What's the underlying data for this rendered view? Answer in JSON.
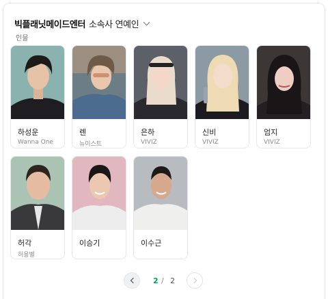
{
  "header": {
    "title_bold": "빅플래닛메이드엔터",
    "title_rest": "소속사 연예인",
    "subtitle": "인물"
  },
  "people": [
    {
      "name": "하성운",
      "group": "Wanna One"
    },
    {
      "name": "렌",
      "group": "뉴이스트"
    },
    {
      "name": "은하",
      "group": "VIVIZ"
    },
    {
      "name": "신비",
      "group": "VIVIZ"
    },
    {
      "name": "엄지",
      "group": "VIVIZ"
    },
    {
      "name": "허각",
      "group": "허용별"
    },
    {
      "name": "이승기",
      "group": ""
    },
    {
      "name": "이수근",
      "group": ""
    }
  ],
  "pagination": {
    "current": "2",
    "separator": "/",
    "total": "2"
  },
  "icons": [
    "chevron-down-icon",
    "chevron-left-icon",
    "chevron-right-icon"
  ],
  "colors": {
    "accent": "#03a94d"
  }
}
